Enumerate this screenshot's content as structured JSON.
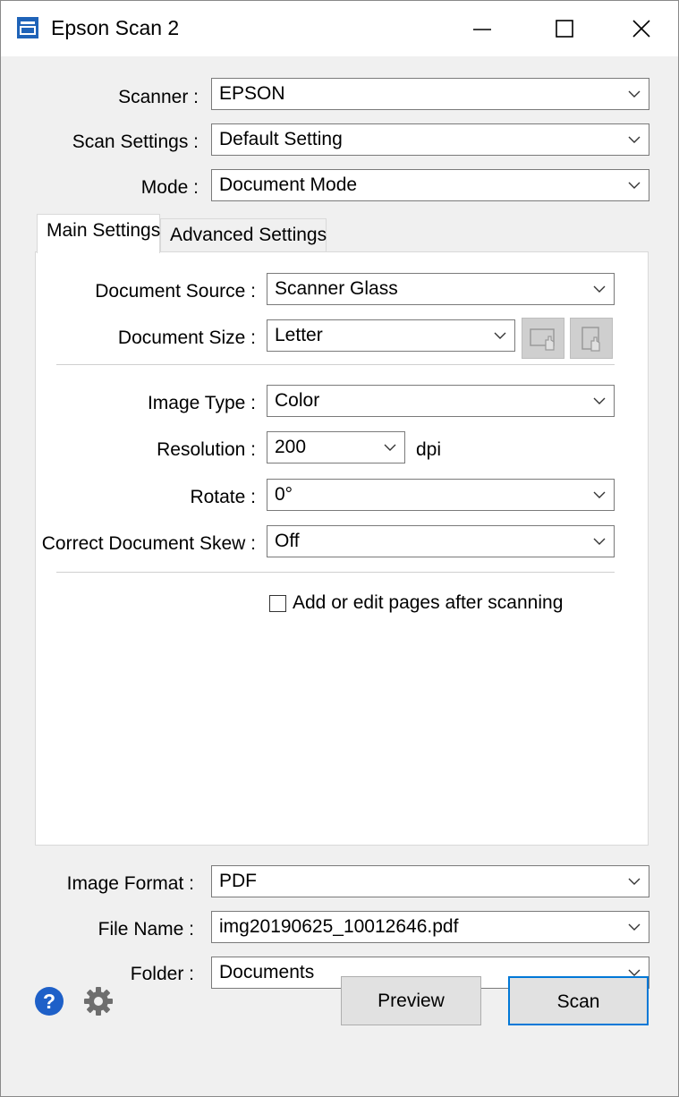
{
  "window": {
    "title": "Epson Scan 2",
    "icon": "epson-scanner-app-icon",
    "controls": [
      "minimize-icon",
      "maximize-icon",
      "close-icon"
    ]
  },
  "top_settings": {
    "scanner": {
      "label": "Scanner :",
      "value": "EPSON"
    },
    "scan_settings": {
      "label": "Scan Settings :",
      "value": "Default Setting"
    },
    "mode": {
      "label": "Mode :",
      "value": "Document Mode"
    }
  },
  "tabs": [
    {
      "label": "Main Settings",
      "selected": true
    },
    {
      "label": "Advanced Settings",
      "selected": false
    }
  ],
  "main_settings": {
    "document_source": {
      "label": "Document Source :",
      "value": "Scanner Glass"
    },
    "document_size": {
      "label": "Document Size :",
      "value": "Letter"
    },
    "image_type": {
      "label": "Image Type :",
      "value": "Color"
    },
    "resolution": {
      "label": "Resolution :",
      "value": "200",
      "unit": "dpi"
    },
    "rotate": {
      "label": "Rotate :",
      "value": "0°"
    },
    "skew": {
      "label": "Correct Document Skew :",
      "value": "Off"
    },
    "add_edit_pages": {
      "label": "Add or edit pages after scanning",
      "checked": false
    }
  },
  "output": {
    "image_format": {
      "label": "Image Format :",
      "value": "PDF"
    },
    "file_name": {
      "label": "File Name :",
      "value": "img20190625_10012646.pdf"
    },
    "folder": {
      "label": "Folder :",
      "value": "Documents"
    }
  },
  "buttons": {
    "preview": "Preview",
    "scan": "Scan"
  },
  "colors": {
    "help_icon": "#1e60c8",
    "gear_icon": "#6e6e6e",
    "default_button_border": "#0078d7"
  }
}
